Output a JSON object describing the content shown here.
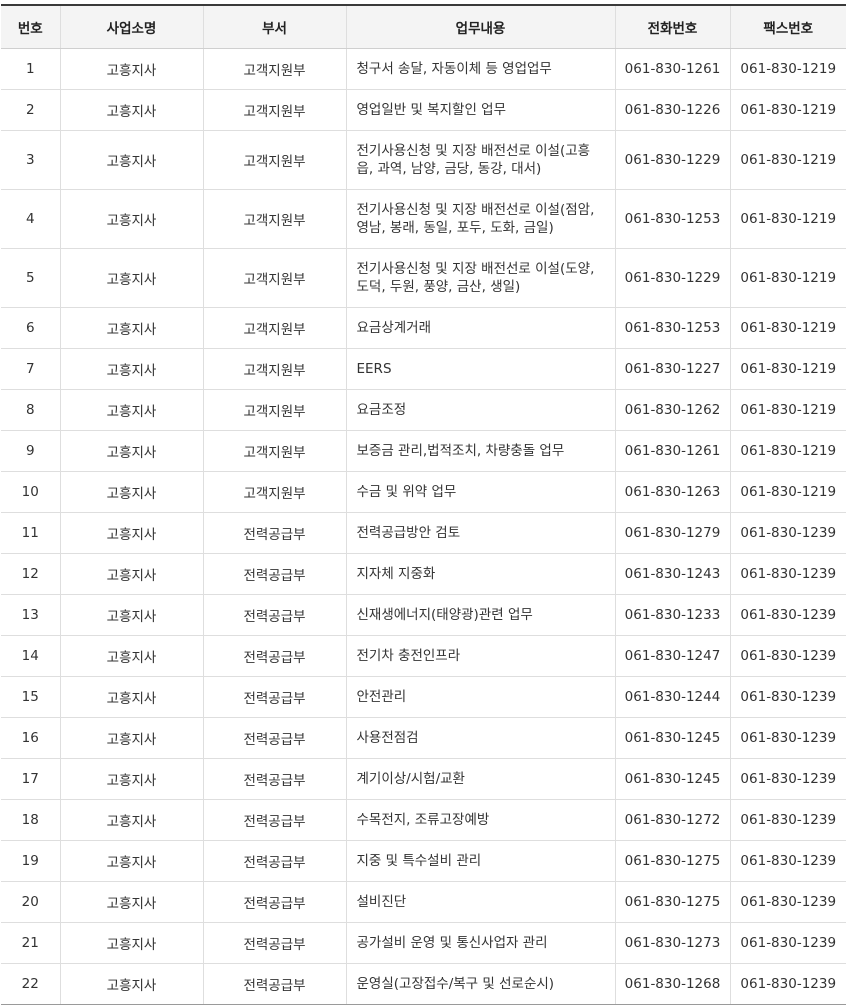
{
  "table": {
    "headers": [
      "번호",
      "사업소명",
      "부서",
      "업무내용",
      "전화번호",
      "팩스번호"
    ],
    "rows": [
      {
        "no": "1",
        "office": "고흥지사",
        "dept": "고객지원부",
        "task": "청구서 송달, 자동이체 등 영업업무",
        "tel": "061-830-1261",
        "fax": "061-830-1219"
      },
      {
        "no": "2",
        "office": "고흥지사",
        "dept": "고객지원부",
        "task": "영업일반 및 복지할인 업무",
        "tel": "061-830-1226",
        "fax": "061-830-1219"
      },
      {
        "no": "3",
        "office": "고흥지사",
        "dept": "고객지원부",
        "task": "전기사용신청 및 지장 배전선로 이설(고흥읍, 과역, 남양, 금당, 동강, 대서)",
        "tel": "061-830-1229",
        "fax": "061-830-1219"
      },
      {
        "no": "4",
        "office": "고흥지사",
        "dept": "고객지원부",
        "task": "전기사용신청 및 지장 배전선로 이설(점암, 영남, 봉래, 동일, 포두, 도화, 금일)",
        "tel": "061-830-1253",
        "fax": "061-830-1219"
      },
      {
        "no": "5",
        "office": "고흥지사",
        "dept": "고객지원부",
        "task": "전기사용신청 및 지장 배전선로 이설(도양, 도덕, 두원, 풍양, 금산, 생일)",
        "tel": "061-830-1229",
        "fax": "061-830-1219"
      },
      {
        "no": "6",
        "office": "고흥지사",
        "dept": "고객지원부",
        "task": "요금상계거래",
        "tel": "061-830-1253",
        "fax": "061-830-1219"
      },
      {
        "no": "7",
        "office": "고흥지사",
        "dept": "고객지원부",
        "task": "EERS",
        "tel": "061-830-1227",
        "fax": "061-830-1219"
      },
      {
        "no": "8",
        "office": "고흥지사",
        "dept": "고객지원부",
        "task": "요금조정",
        "tel": "061-830-1262",
        "fax": "061-830-1219"
      },
      {
        "no": "9",
        "office": "고흥지사",
        "dept": "고객지원부",
        "task": "보증금 관리,법적조치, 차량충돌 업무",
        "tel": "061-830-1261",
        "fax": "061-830-1219"
      },
      {
        "no": "10",
        "office": "고흥지사",
        "dept": "고객지원부",
        "task": "수금 및 위약 업무",
        "tel": "061-830-1263",
        "fax": "061-830-1219"
      },
      {
        "no": "11",
        "office": "고흥지사",
        "dept": "전력공급부",
        "task": "전력공급방안 검토",
        "tel": "061-830-1279",
        "fax": "061-830-1239"
      },
      {
        "no": "12",
        "office": "고흥지사",
        "dept": "전력공급부",
        "task": "지자체 지중화",
        "tel": "061-830-1243",
        "fax": "061-830-1239"
      },
      {
        "no": "13",
        "office": "고흥지사",
        "dept": "전력공급부",
        "task": "신재생에너지(태양광)관련 업무",
        "tel": "061-830-1233",
        "fax": "061-830-1239"
      },
      {
        "no": "14",
        "office": "고흥지사",
        "dept": "전력공급부",
        "task": "전기차 충전인프라",
        "tel": "061-830-1247",
        "fax": "061-830-1239"
      },
      {
        "no": "15",
        "office": "고흥지사",
        "dept": "전력공급부",
        "task": "안전관리",
        "tel": "061-830-1244",
        "fax": "061-830-1239"
      },
      {
        "no": "16",
        "office": "고흥지사",
        "dept": "전력공급부",
        "task": "사용전점검",
        "tel": "061-830-1245",
        "fax": "061-830-1239"
      },
      {
        "no": "17",
        "office": "고흥지사",
        "dept": "전력공급부",
        "task": "계기이상/시험/교환",
        "tel": "061-830-1245",
        "fax": "061-830-1239"
      },
      {
        "no": "18",
        "office": "고흥지사",
        "dept": "전력공급부",
        "task": "수목전지, 조류고장예방",
        "tel": "061-830-1272",
        "fax": "061-830-1239"
      },
      {
        "no": "19",
        "office": "고흥지사",
        "dept": "전력공급부",
        "task": "지중 및 특수설비 관리",
        "tel": "061-830-1275",
        "fax": "061-830-1239"
      },
      {
        "no": "20",
        "office": "고흥지사",
        "dept": "전력공급부",
        "task": "설비진단",
        "tel": "061-830-1275",
        "fax": "061-830-1239"
      },
      {
        "no": "21",
        "office": "고흥지사",
        "dept": "전력공급부",
        "task": "공가설비 운영 및 통신사업자 관리",
        "tel": "061-830-1273",
        "fax": "061-830-1239"
      },
      {
        "no": "22",
        "office": "고흥지사",
        "dept": "전력공급부",
        "task": "운영실(고장접수/복구 및 선로순시)",
        "tel": "061-830-1268",
        "fax": "061-830-1239"
      }
    ]
  }
}
